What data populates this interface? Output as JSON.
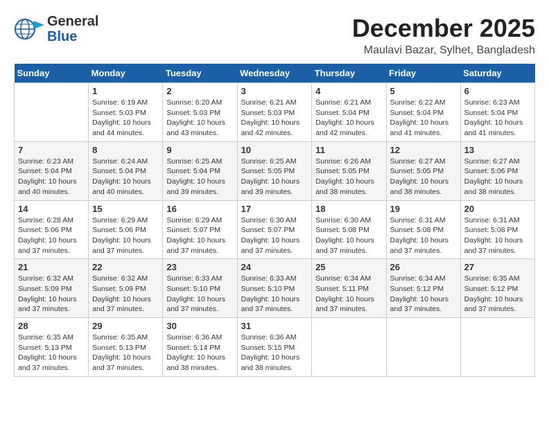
{
  "header": {
    "logo_line1": "General",
    "logo_line2": "Blue",
    "month_year": "December 2025",
    "location": "Maulavi Bazar, Sylhet, Bangladesh"
  },
  "weekdays": [
    "Sunday",
    "Monday",
    "Tuesday",
    "Wednesday",
    "Thursday",
    "Friday",
    "Saturday"
  ],
  "weeks": [
    [
      {
        "day": "",
        "info": ""
      },
      {
        "day": "1",
        "info": "Sunrise: 6:19 AM\nSunset: 5:03 PM\nDaylight: 10 hours\nand 44 minutes."
      },
      {
        "day": "2",
        "info": "Sunrise: 6:20 AM\nSunset: 5:03 PM\nDaylight: 10 hours\nand 43 minutes."
      },
      {
        "day": "3",
        "info": "Sunrise: 6:21 AM\nSunset: 5:03 PM\nDaylight: 10 hours\nand 42 minutes."
      },
      {
        "day": "4",
        "info": "Sunrise: 6:21 AM\nSunset: 5:04 PM\nDaylight: 10 hours\nand 42 minutes."
      },
      {
        "day": "5",
        "info": "Sunrise: 6:22 AM\nSunset: 5:04 PM\nDaylight: 10 hours\nand 41 minutes."
      },
      {
        "day": "6",
        "info": "Sunrise: 6:23 AM\nSunset: 5:04 PM\nDaylight: 10 hours\nand 41 minutes."
      }
    ],
    [
      {
        "day": "7",
        "info": "Sunrise: 6:23 AM\nSunset: 5:04 PM\nDaylight: 10 hours\nand 40 minutes."
      },
      {
        "day": "8",
        "info": "Sunrise: 6:24 AM\nSunset: 5:04 PM\nDaylight: 10 hours\nand 40 minutes."
      },
      {
        "day": "9",
        "info": "Sunrise: 6:25 AM\nSunset: 5:04 PM\nDaylight: 10 hours\nand 39 minutes."
      },
      {
        "day": "10",
        "info": "Sunrise: 6:25 AM\nSunset: 5:05 PM\nDaylight: 10 hours\nand 39 minutes."
      },
      {
        "day": "11",
        "info": "Sunrise: 6:26 AM\nSunset: 5:05 PM\nDaylight: 10 hours\nand 38 minutes."
      },
      {
        "day": "12",
        "info": "Sunrise: 6:27 AM\nSunset: 5:05 PM\nDaylight: 10 hours\nand 38 minutes."
      },
      {
        "day": "13",
        "info": "Sunrise: 6:27 AM\nSunset: 5:06 PM\nDaylight: 10 hours\nand 38 minutes."
      }
    ],
    [
      {
        "day": "14",
        "info": "Sunrise: 6:28 AM\nSunset: 5:06 PM\nDaylight: 10 hours\nand 37 minutes."
      },
      {
        "day": "15",
        "info": "Sunrise: 6:29 AM\nSunset: 5:06 PM\nDaylight: 10 hours\nand 37 minutes."
      },
      {
        "day": "16",
        "info": "Sunrise: 6:29 AM\nSunset: 5:07 PM\nDaylight: 10 hours\nand 37 minutes."
      },
      {
        "day": "17",
        "info": "Sunrise: 6:30 AM\nSunset: 5:07 PM\nDaylight: 10 hours\nand 37 minutes."
      },
      {
        "day": "18",
        "info": "Sunrise: 6:30 AM\nSunset: 5:08 PM\nDaylight: 10 hours\nand 37 minutes."
      },
      {
        "day": "19",
        "info": "Sunrise: 6:31 AM\nSunset: 5:08 PM\nDaylight: 10 hours\nand 37 minutes."
      },
      {
        "day": "20",
        "info": "Sunrise: 6:31 AM\nSunset: 5:08 PM\nDaylight: 10 hours\nand 37 minutes."
      }
    ],
    [
      {
        "day": "21",
        "info": "Sunrise: 6:32 AM\nSunset: 5:09 PM\nDaylight: 10 hours\nand 37 minutes."
      },
      {
        "day": "22",
        "info": "Sunrise: 6:32 AM\nSunset: 5:09 PM\nDaylight: 10 hours\nand 37 minutes."
      },
      {
        "day": "23",
        "info": "Sunrise: 6:33 AM\nSunset: 5:10 PM\nDaylight: 10 hours\nand 37 minutes."
      },
      {
        "day": "24",
        "info": "Sunrise: 6:33 AM\nSunset: 5:10 PM\nDaylight: 10 hours\nand 37 minutes."
      },
      {
        "day": "25",
        "info": "Sunrise: 6:34 AM\nSunset: 5:11 PM\nDaylight: 10 hours\nand 37 minutes."
      },
      {
        "day": "26",
        "info": "Sunrise: 6:34 AM\nSunset: 5:12 PM\nDaylight: 10 hours\nand 37 minutes."
      },
      {
        "day": "27",
        "info": "Sunrise: 6:35 AM\nSunset: 5:12 PM\nDaylight: 10 hours\nand 37 minutes."
      }
    ],
    [
      {
        "day": "28",
        "info": "Sunrise: 6:35 AM\nSunset: 5:13 PM\nDaylight: 10 hours\nand 37 minutes."
      },
      {
        "day": "29",
        "info": "Sunrise: 6:35 AM\nSunset: 5:13 PM\nDaylight: 10 hours\nand 37 minutes."
      },
      {
        "day": "30",
        "info": "Sunrise: 6:36 AM\nSunset: 5:14 PM\nDaylight: 10 hours\nand 38 minutes."
      },
      {
        "day": "31",
        "info": "Sunrise: 6:36 AM\nSunset: 5:15 PM\nDaylight: 10 hours\nand 38 minutes."
      },
      {
        "day": "",
        "info": ""
      },
      {
        "day": "",
        "info": ""
      },
      {
        "day": "",
        "info": ""
      }
    ]
  ]
}
